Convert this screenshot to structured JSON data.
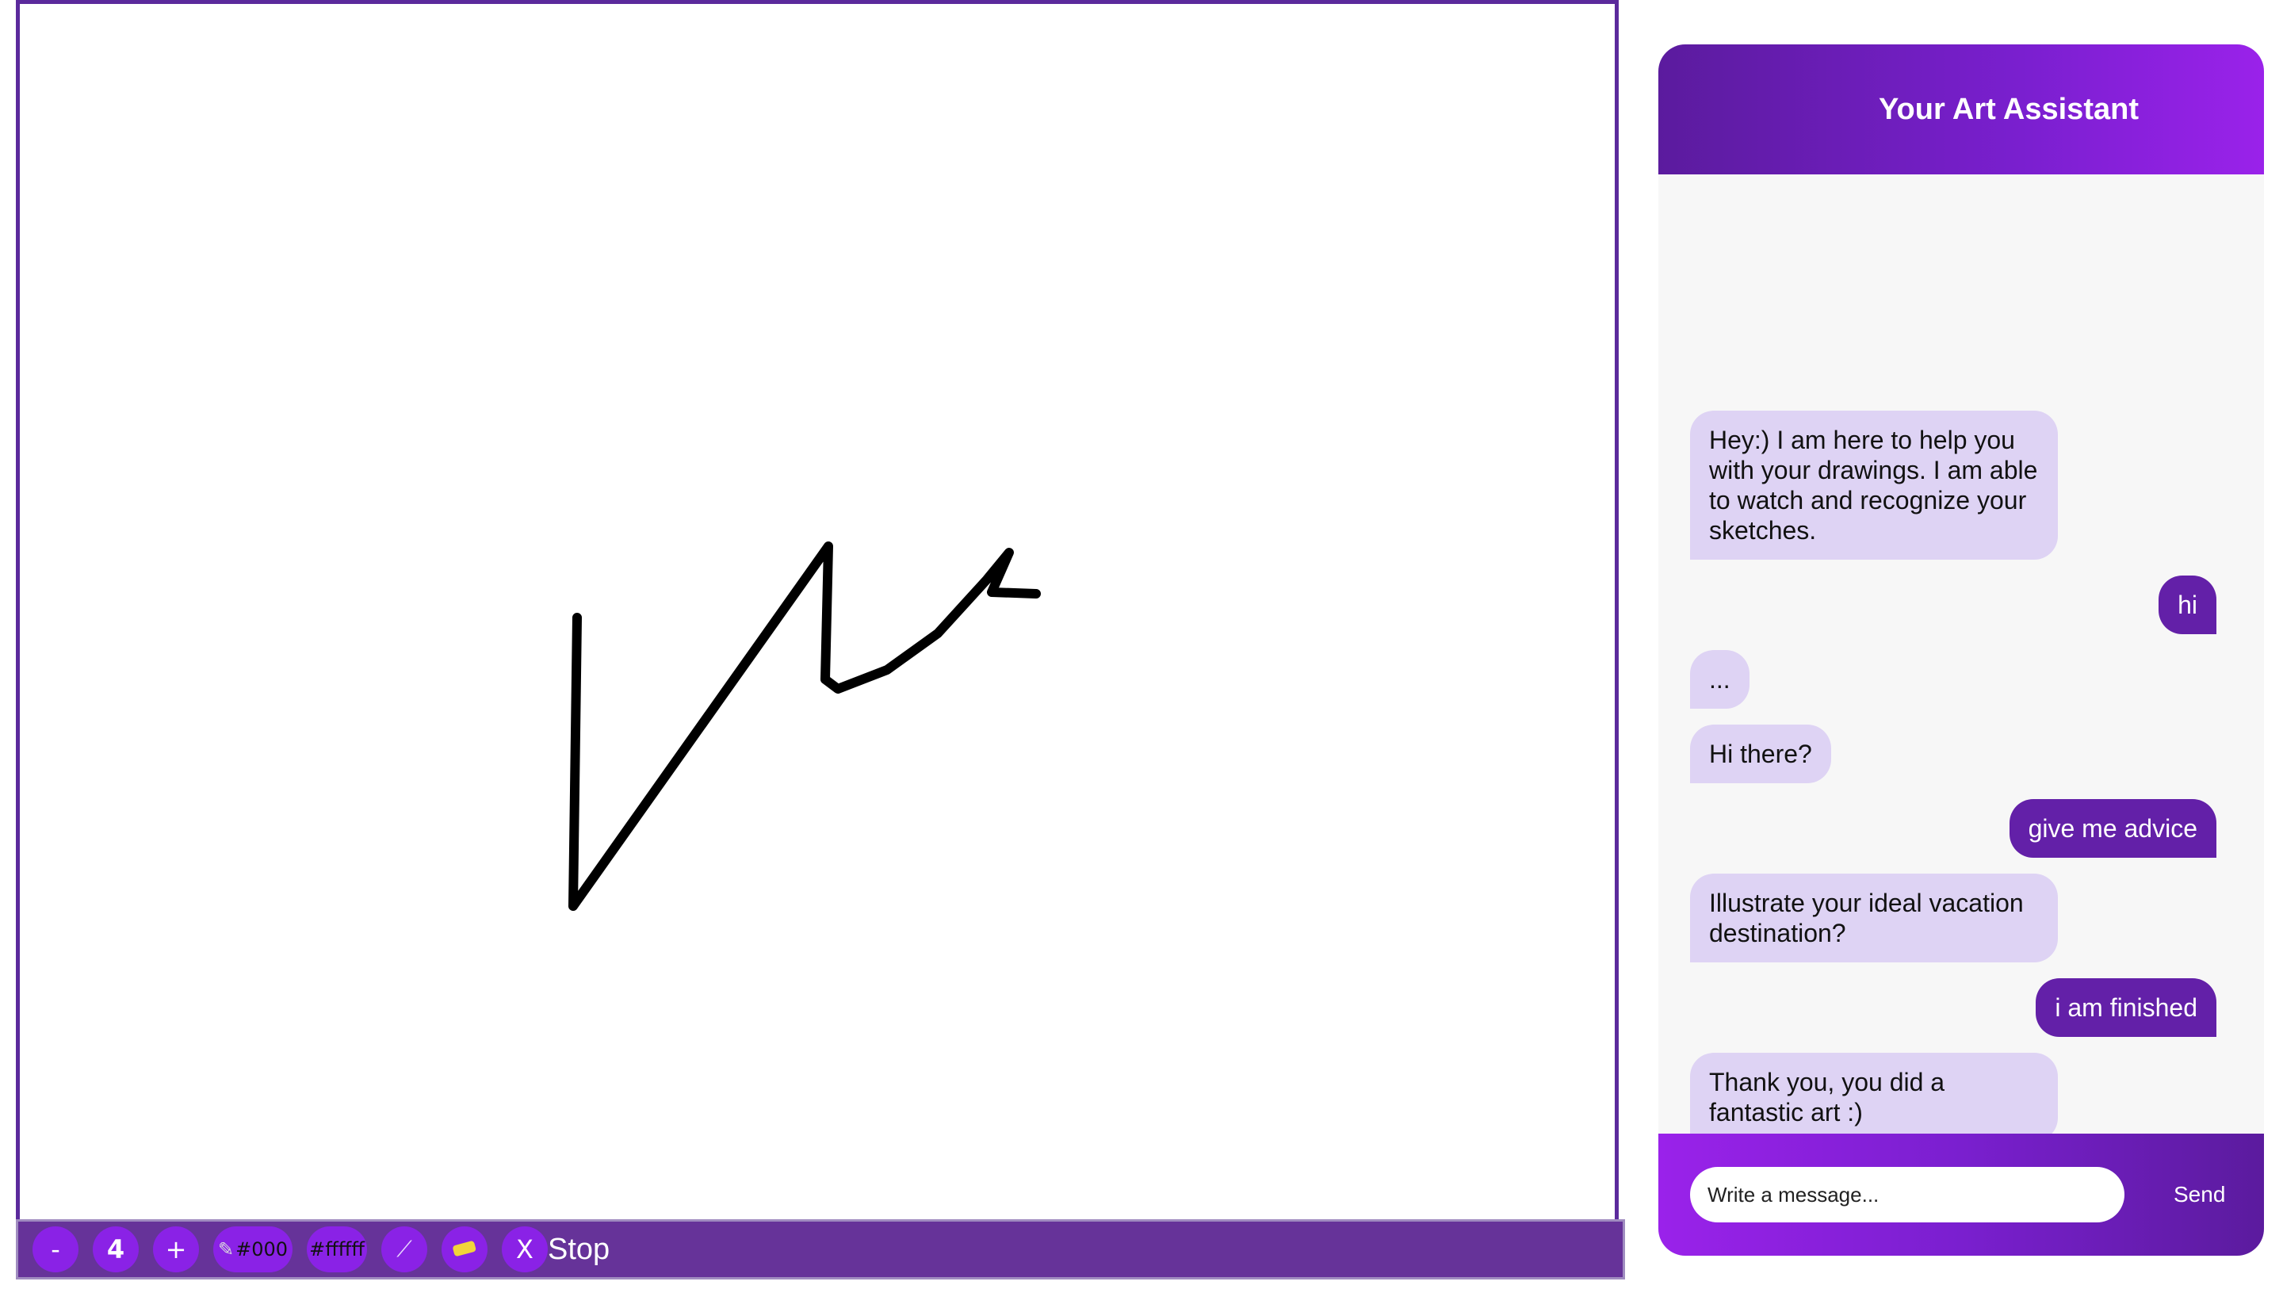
{
  "toolbar": {
    "minus_label": "-",
    "size_value": "4",
    "plus_label": "+",
    "pen_color_label": "#000",
    "bg_color_label": "#ffffff",
    "clear_label": "X",
    "stop_label": "Stop"
  },
  "icons": {
    "pen": "pencil-icon",
    "magic": "magic-wand-icon",
    "eraser": "eraser-icon"
  },
  "chat": {
    "title": "Your Art Assistant",
    "messages": [
      {
        "role": "bot",
        "text": "Hey:) I am here to help you with your drawings. I am able to watch and recognize your sketches."
      },
      {
        "role": "user",
        "text": "hi"
      },
      {
        "role": "bot",
        "text": "..."
      },
      {
        "role": "bot",
        "text": "Hi there?"
      },
      {
        "role": "user",
        "text": "give me advice"
      },
      {
        "role": "bot",
        "text": "Illustrate your ideal vacation destination?"
      },
      {
        "role": "user",
        "text": "i am finished"
      },
      {
        "role": "bot",
        "text": "Thank you, you did a fantastic art :)"
      }
    ],
    "input_placeholder": "Write a message...",
    "send_label": "Send"
  },
  "colors": {
    "accent": "#8a22e6",
    "toolbar_bg": "#663399",
    "bot_bubble": "#ded3f4",
    "user_bubble": "#6320a8"
  }
}
